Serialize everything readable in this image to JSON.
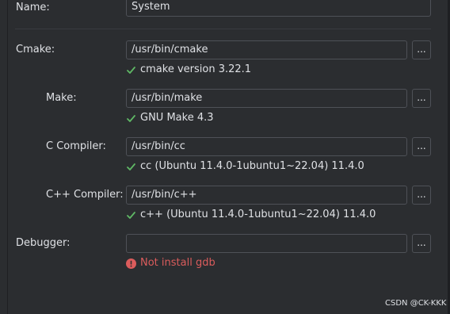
{
  "name": {
    "label": "Name:",
    "value": "System"
  },
  "cmake": {
    "label": "Cmake:",
    "value": "/usr/bin/cmake",
    "browse_label": "...",
    "status": "cmake version 3.22.1",
    "status_icon": "check-icon"
  },
  "make": {
    "label": "Make:",
    "value": "/usr/bin/make",
    "browse_label": "...",
    "status": "GNU Make 4.3",
    "status_icon": "check-icon"
  },
  "c_compiler": {
    "label": "C Compiler:",
    "value": "/usr/bin/cc",
    "browse_label": "...",
    "status": "cc (Ubuntu 11.4.0-1ubuntu1~22.04) 11.4.0",
    "status_icon": "check-icon"
  },
  "cpp_compiler": {
    "label": "C++ Compiler:",
    "value": "/usr/bin/c++",
    "browse_label": "...",
    "status": "c++ (Ubuntu 11.4.0-1ubuntu1~22.04) 11.4.0",
    "status_icon": "check-icon"
  },
  "debugger": {
    "label": "Debugger:",
    "value": "",
    "browse_label": "...",
    "status": "Not install gdb",
    "status_icon": "error-icon"
  },
  "watermark": "CSDN @CK-KKK",
  "colors": {
    "background": "#2b2d30",
    "border": "#4e5157",
    "ok": "#5fb865",
    "error": "#db5c5c",
    "text": "#dfe1e5"
  }
}
